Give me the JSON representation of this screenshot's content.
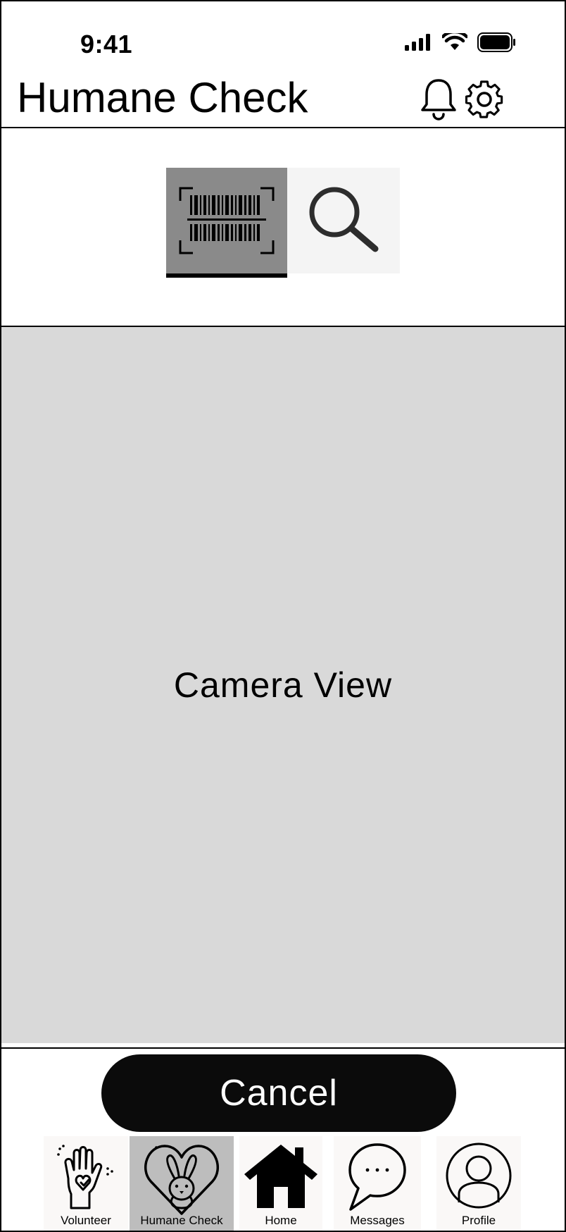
{
  "status_bar": {
    "time": "9:41",
    "icons": [
      "cellular-signal-icon",
      "wifi-icon",
      "battery-icon"
    ]
  },
  "header": {
    "title": "Humane Check",
    "actions": [
      "bell-icon",
      "gear-icon"
    ]
  },
  "mode_selector": {
    "modes": [
      {
        "icon": "barcode-scan-icon",
        "selected": true
      },
      {
        "icon": "search-icon",
        "selected": false
      }
    ]
  },
  "camera": {
    "label": "Camera View"
  },
  "actions": {
    "cancel_label": "Cancel"
  },
  "bottom_nav": {
    "items": [
      {
        "label": "Volunteer",
        "icon": "volunteer-hand-icon",
        "active": false
      },
      {
        "label": "Humane Check",
        "icon": "bunny-heart-icon",
        "active": true
      },
      {
        "label": "Home",
        "icon": "home-icon",
        "active": false
      },
      {
        "label": "Messages",
        "icon": "chat-bubble-icon",
        "active": false
      },
      {
        "label": "Profile",
        "icon": "profile-icon",
        "active": false
      }
    ]
  },
  "colors": {
    "camera_background": "#d9d9d9",
    "active_mode": "#8a8a8a",
    "active_nav": "#bdbdbd",
    "button_background": "#0b0b0b"
  }
}
